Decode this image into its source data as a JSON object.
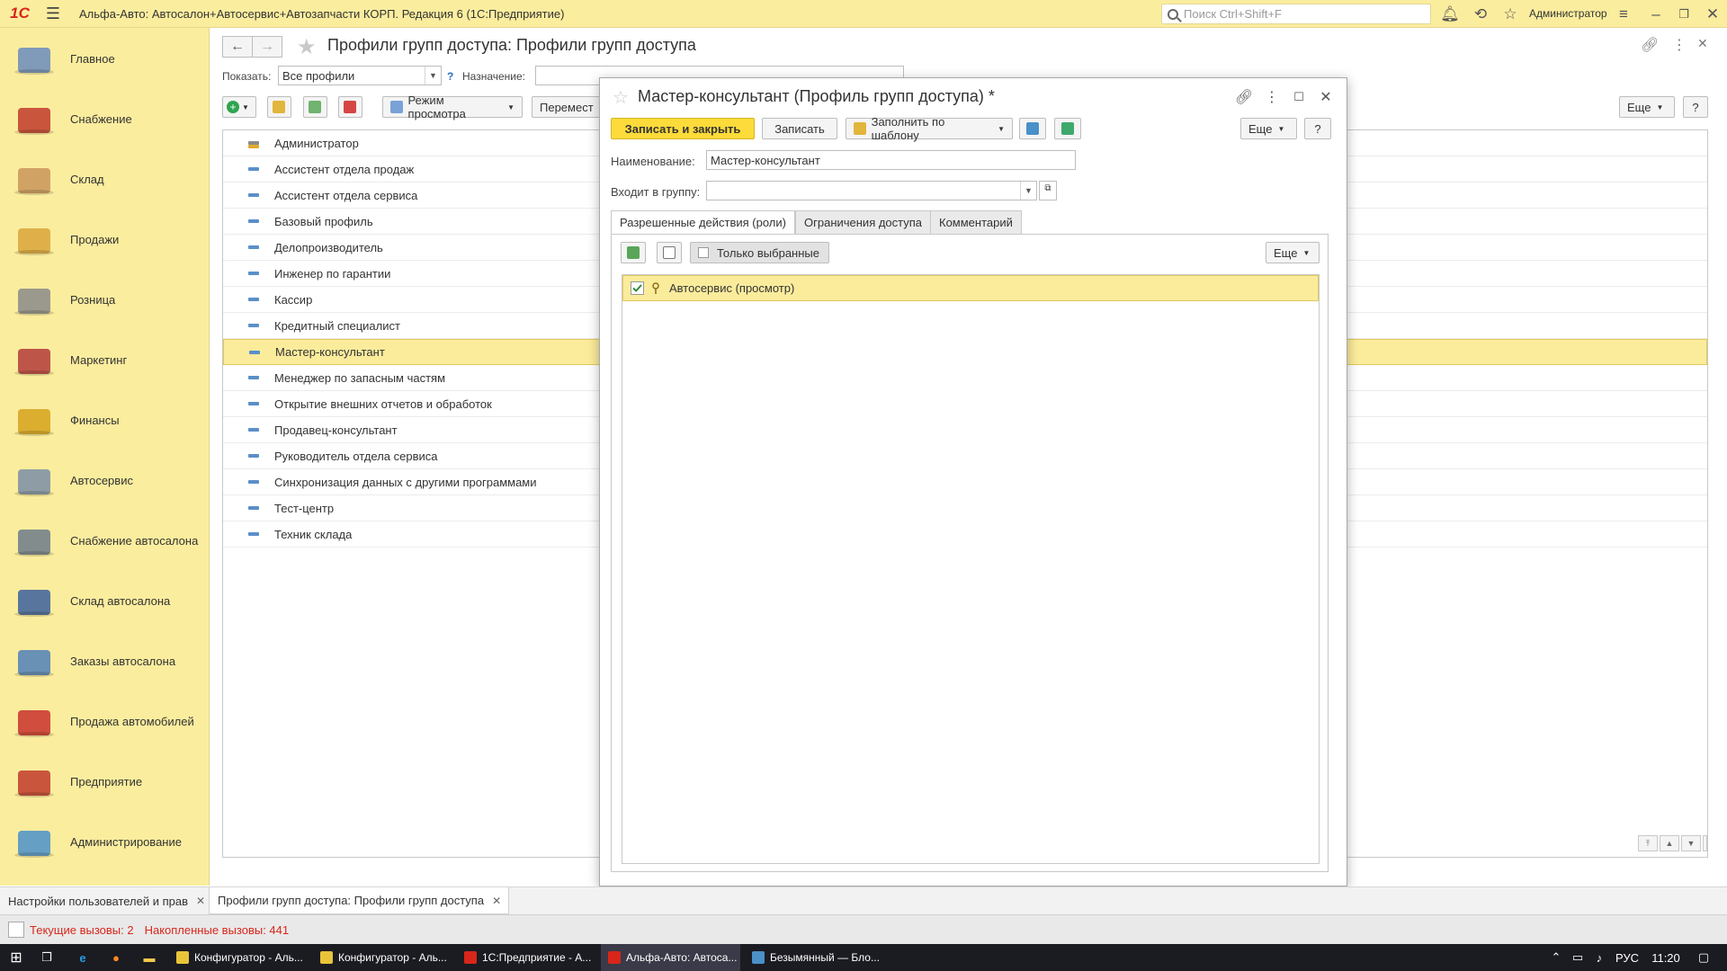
{
  "window": {
    "title": "Альфа-Авто: Автосалон+Автосервис+Автозапчасти КОРП. Редакция 6  (1С:Предприятие)",
    "search_placeholder": "Поиск Ctrl+Shift+F",
    "user": "Администратор"
  },
  "sidebar": {
    "items": [
      {
        "label": "Главное",
        "icon": "desk-icon",
        "color": "#6a8bbd"
      },
      {
        "label": "Снабжение",
        "icon": "truck-icon",
        "color": "#c0392b"
      },
      {
        "label": "Склад",
        "icon": "boxes-icon",
        "color": "#c8955b"
      },
      {
        "label": "Продажи",
        "icon": "sales-icon",
        "color": "#d9a43a"
      },
      {
        "label": "Розница",
        "icon": "cash-register-icon",
        "color": "#8a8a8a"
      },
      {
        "label": "Маркетинг",
        "icon": "chart-board-icon",
        "color": "#b33a3a"
      },
      {
        "label": "Финансы",
        "icon": "coins-icon",
        "color": "#d6a21c"
      },
      {
        "label": "Автосервис",
        "icon": "gears-icon",
        "color": "#7a8ea6"
      },
      {
        "label": "Снабжение автосалона",
        "icon": "calculator-icon",
        "color": "#6c7a89"
      },
      {
        "label": "Склад автосалона",
        "icon": "garage-icon",
        "color": "#3b5f9c"
      },
      {
        "label": "Заказы автосалона",
        "icon": "manager-icon",
        "color": "#4f7fb8"
      },
      {
        "label": "Продажа автомобилей",
        "icon": "red-car-icon",
        "color": "#c9302c"
      },
      {
        "label": "Предприятие",
        "icon": "building-icon",
        "color": "#c0392b"
      },
      {
        "label": "Администрирование",
        "icon": "computer-icon",
        "color": "#4a90c9"
      }
    ]
  },
  "main": {
    "title": "Профили групп доступа: Профили групп доступа",
    "show_label": "Показать:",
    "show_value": "Все профили",
    "help_mark": "?",
    "purpose_label": "Назначение:",
    "view_mode_button": "Режим просмотра",
    "move_button": "Перемест",
    "more_button": "Еще",
    "help_button": "?",
    "rows": [
      "Администратор",
      "Ассистент отдела продаж",
      "Ассистент отдела сервиса",
      "Базовый профиль",
      "Делопроизводитель",
      "Инженер по гарантии",
      "Кассир",
      "Кредитный специалист",
      "Мастер-консультант",
      "Менеджер по запасным частям",
      "Открытие внешних отчетов и обработок",
      "Продавец-консультант",
      "Руководитель отдела сервиса",
      "Синхронизация данных с другими программами",
      "Тест-центр",
      "Техник склада"
    ],
    "selected_row": "Мастер-консультант"
  },
  "modal": {
    "title": "Мастер-консультант (Профиль групп доступа) *",
    "save_close_button": "Записать и закрыть",
    "save_button": "Записать",
    "fill_template_button": "Заполнить по шаблону",
    "more_button": "Еще",
    "help_button": "?",
    "name_label": "Наименование:",
    "name_value": "Мастер-консультант",
    "group_label": "Входит в группу:",
    "group_value": "",
    "tabs": [
      "Разрешенные действия (роли)",
      "Ограничения доступа",
      "Комментарий"
    ],
    "only_selected_label": "Только выбранные",
    "panel_more_button": "Еще",
    "roles": [
      {
        "label": "Автосервис (просмотр)",
        "checked": true
      }
    ]
  },
  "open_tabs": [
    {
      "label": "Настройки пользователей и прав"
    },
    {
      "label": "Профили групп доступа: Профили групп доступа"
    }
  ],
  "status": {
    "current_calls": "Текущие вызовы: 2",
    "accumulated_calls": "Накопленные вызовы: 441"
  },
  "taskbar": {
    "items": [
      "Конфигуратор - Аль...",
      "Конфигуратор - Аль...",
      "1С:Предприятие - А...",
      "Альфа-Авто: Автоса...",
      "Безымянный — Бло..."
    ],
    "lang": "РУС",
    "time": "11:20"
  },
  "colors": {
    "accent_yellow": "#fbed9e",
    "primary_button": "#fcdb3a",
    "selection": "#fbec9c",
    "status_red": "#d8261b"
  }
}
